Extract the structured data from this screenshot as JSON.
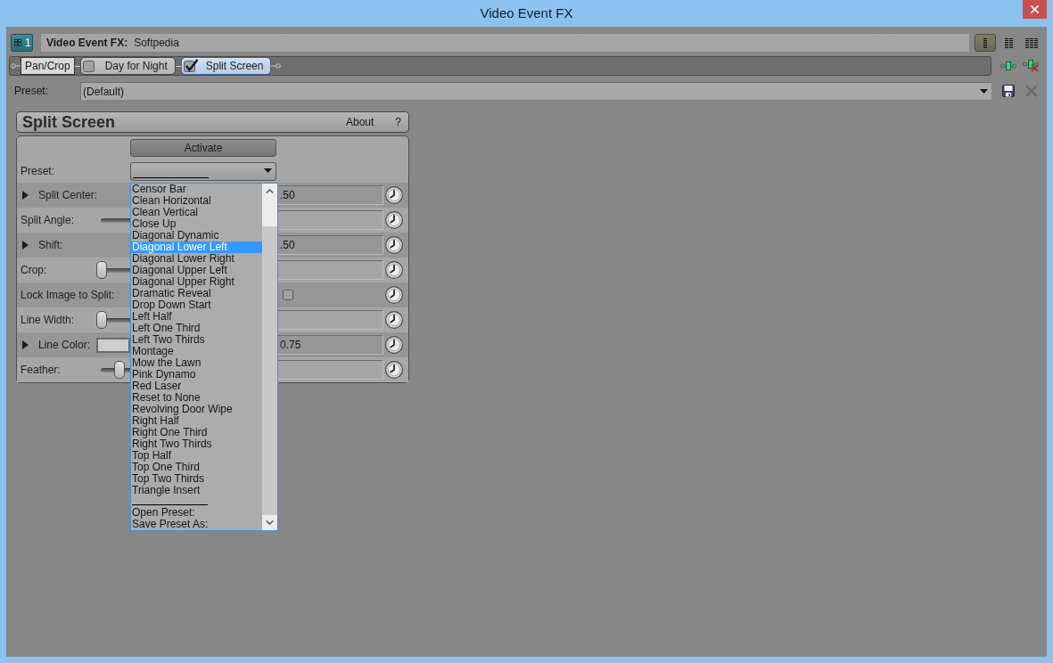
{
  "window": {
    "title": "Video Event FX"
  },
  "header": {
    "track_number": "1",
    "label": "Video Event FX:",
    "value": "Softpedia",
    "view_buttons": [
      {
        "selected": true
      },
      {
        "selected": false
      },
      {
        "selected": false
      }
    ]
  },
  "chain": {
    "plugins": [
      {
        "label": "Pan/Crop",
        "kind": "plain",
        "selected": false
      },
      {
        "label": "Day for Night",
        "kind": "toggle",
        "checked": false,
        "selected": false
      },
      {
        "label": "Split Screen",
        "kind": "toggle",
        "checked": true,
        "selected": true
      }
    ]
  },
  "preset": {
    "label": "Preset:",
    "value": "(Default)"
  },
  "panel": {
    "title": "Split Screen",
    "links": [
      "About",
      "?"
    ],
    "activate": "Activate",
    "rows": [
      {
        "kind": "dropdown",
        "label": "Preset:"
      },
      {
        "kind": "value",
        "label": "Split Center:",
        "expanded": false,
        "value": ".50"
      },
      {
        "kind": "slider",
        "label": "Split Angle:"
      },
      {
        "kind": "value",
        "label": "Shift:",
        "expanded": false,
        "value": ".50"
      },
      {
        "kind": "slider",
        "label": "Crop:",
        "level": 0
      },
      {
        "kind": "checkbox",
        "label": "Lock Image to Split:",
        "checked": false
      },
      {
        "kind": "slider",
        "label": "Line Width:",
        "level": 0
      },
      {
        "kind": "color",
        "label": "Line Color:",
        "expanded": false,
        "value": "0.75"
      },
      {
        "kind": "slider",
        "label": "Feather:",
        "level": 0.77
      }
    ]
  },
  "menu": {
    "items": [
      {
        "kind": "option",
        "label": "Censor Bar",
        "selected": false
      },
      {
        "kind": "option",
        "label": "Clean Horizontal",
        "selected": false
      },
      {
        "kind": "option",
        "label": "Clean Vertical",
        "selected": false
      },
      {
        "kind": "option",
        "label": "Close Up",
        "selected": false
      },
      {
        "kind": "option",
        "label": "Diagonal Dynamic",
        "selected": false
      },
      {
        "kind": "option",
        "label": "Diagonal Lower Left",
        "selected": true
      },
      {
        "kind": "option",
        "label": "Diagonal Lower Right",
        "selected": false
      },
      {
        "kind": "option",
        "label": "Diagonal Upper Left",
        "selected": false
      },
      {
        "kind": "option",
        "label": "Diagonal Upper Right",
        "selected": false
      },
      {
        "kind": "option",
        "label": "Dramatic Reveal",
        "selected": false
      },
      {
        "kind": "option",
        "label": "Drop Down Start",
        "selected": false
      },
      {
        "kind": "option",
        "label": "Left Half",
        "selected": false
      },
      {
        "kind": "option",
        "label": "Left One Third",
        "selected": false
      },
      {
        "kind": "option",
        "label": "Left Two Thirds",
        "selected": false
      },
      {
        "kind": "option",
        "label": "Montage",
        "selected": false
      },
      {
        "kind": "option",
        "label": "Mow the Lawn",
        "selected": false
      },
      {
        "kind": "option",
        "label": "Pink Dynamo",
        "selected": false
      },
      {
        "kind": "option",
        "label": "Red Laser",
        "selected": false
      },
      {
        "kind": "option",
        "label": "Reset to None",
        "selected": false
      },
      {
        "kind": "option",
        "label": "Revolving Door Wipe",
        "selected": false
      },
      {
        "kind": "option",
        "label": "Right Half",
        "selected": false
      },
      {
        "kind": "option",
        "label": "Right One Third",
        "selected": false
      },
      {
        "kind": "option",
        "label": "Right Two Thirds",
        "selected": false
      },
      {
        "kind": "option",
        "label": "Top Half",
        "selected": false
      },
      {
        "kind": "option",
        "label": "Top One Third",
        "selected": false
      },
      {
        "kind": "option",
        "label": "Top Two Thirds",
        "selected": false
      },
      {
        "kind": "option",
        "label": "Triangle Insert",
        "selected": false
      },
      {
        "kind": "separator"
      },
      {
        "kind": "option",
        "label": "Open Preset:",
        "selected": false
      },
      {
        "kind": "option",
        "label": "Save Preset As:",
        "selected": false
      }
    ]
  }
}
